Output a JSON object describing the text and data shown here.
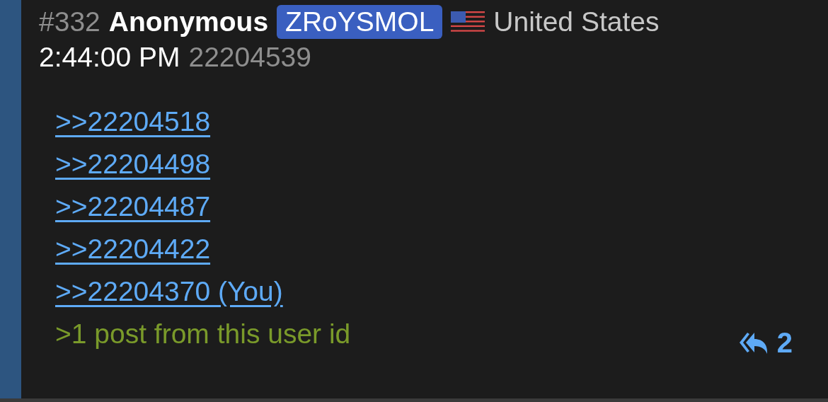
{
  "post": {
    "number": "#332",
    "name": "Anonymous",
    "user_id": "ZRoYSMOL",
    "country": "United States",
    "time": "2:44:00 PM",
    "post_id": "22204539"
  },
  "quotes": [
    {
      "text": ">>22204518"
    },
    {
      "text": ">>22204498"
    },
    {
      "text": ">>22204487"
    },
    {
      "text": ">>22204422"
    },
    {
      "text": ">>22204370 (You)"
    }
  ],
  "greentext": ">1 post from this user id",
  "reply_count": "2"
}
